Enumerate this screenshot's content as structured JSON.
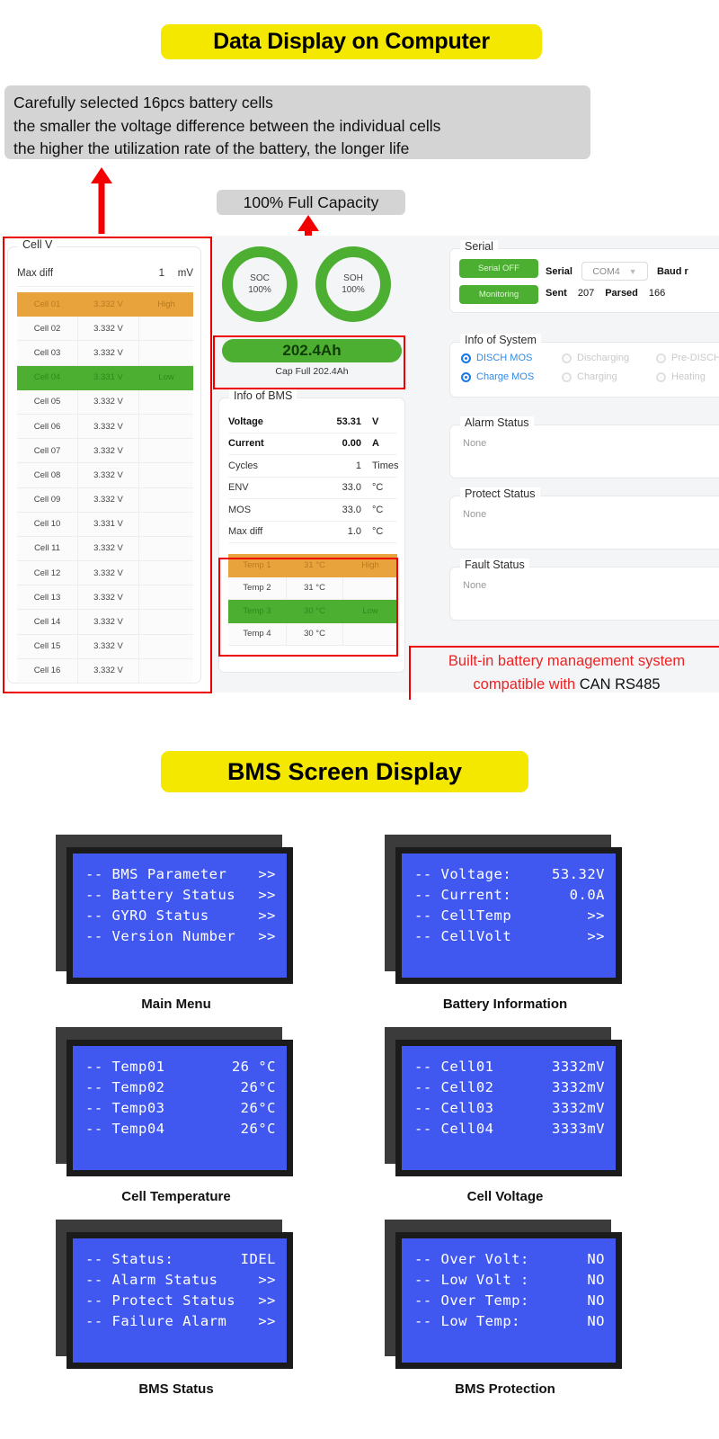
{
  "banners": {
    "top": "Data Display on Computer",
    "bms": "BMS Screen Display"
  },
  "note": {
    "line1": "Carefully selected 16pcs battery cells",
    "line2": "the smaller the voltage difference between the individual cells",
    "line3": "the higher the utilization rate of the battery, the longer life"
  },
  "capacity_tag": "100% Full Capacity",
  "can_note": {
    "line1": "Built-in battery management system",
    "line2_red": "compatible with ",
    "line2_black": "CAN RS485"
  },
  "cell_panel": {
    "legend": "Cell V",
    "max_diff_label": "Max diff",
    "max_diff_value": "1",
    "max_diff_unit": "mV",
    "rows": [
      {
        "name": "Cell 01",
        "voltage": "3.332 V",
        "status": "High",
        "state": "hi"
      },
      {
        "name": "Cell 02",
        "voltage": "3.332 V",
        "status": "",
        "state": ""
      },
      {
        "name": "Cell 03",
        "voltage": "3.332 V",
        "status": "",
        "state": ""
      },
      {
        "name": "Cell 04",
        "voltage": "3.331 V",
        "status": "Low",
        "state": "lo"
      },
      {
        "name": "Cell 05",
        "voltage": "3.332 V",
        "status": "",
        "state": ""
      },
      {
        "name": "Cell 06",
        "voltage": "3.332 V",
        "status": "",
        "state": ""
      },
      {
        "name": "Cell 07",
        "voltage": "3.332 V",
        "status": "",
        "state": ""
      },
      {
        "name": "Cell 08",
        "voltage": "3.332 V",
        "status": "",
        "state": ""
      },
      {
        "name": "Cell 09",
        "voltage": "3.332 V",
        "status": "",
        "state": ""
      },
      {
        "name": "Cell 10",
        "voltage": "3.331 V",
        "status": "",
        "state": ""
      },
      {
        "name": "Cell 11",
        "voltage": "3.332 V",
        "status": "",
        "state": ""
      },
      {
        "name": "Cell 12",
        "voltage": "3.332 V",
        "status": "",
        "state": ""
      },
      {
        "name": "Cell 13",
        "voltage": "3.332 V",
        "status": "",
        "state": ""
      },
      {
        "name": "Cell 14",
        "voltage": "3.332 V",
        "status": "",
        "state": ""
      },
      {
        "name": "Cell 15",
        "voltage": "3.332 V",
        "status": "",
        "state": ""
      },
      {
        "name": "Cell 16",
        "voltage": "3.332 V",
        "status": "",
        "state": ""
      }
    ]
  },
  "gauges": {
    "soc": {
      "label": "SOC",
      "value": "100%"
    },
    "soh": {
      "label": "SOH",
      "value": "100%"
    }
  },
  "capacity": {
    "bar": "202.4Ah",
    "sub": "Cap Full  202.4Ah"
  },
  "bms_info": {
    "legend": "Info of BMS",
    "rows": [
      {
        "label": "Voltage",
        "value": "53.31",
        "unit": "V",
        "bold": true
      },
      {
        "label": "Current",
        "value": "0.00",
        "unit": "A",
        "bold": true
      },
      {
        "label": "Cycles",
        "value": "1",
        "unit": "Times",
        "bold": false
      },
      {
        "label": "ENV",
        "value": "33.0",
        "unit": "°C",
        "bold": false
      },
      {
        "label": "MOS",
        "value": "33.0",
        "unit": "°C",
        "bold": false
      },
      {
        "label": "Max diff",
        "value": "1.0",
        "unit": "°C",
        "bold": false
      }
    ],
    "temps": [
      {
        "name": "Temp 1",
        "value": "31 °C",
        "status": "High",
        "state": "hi"
      },
      {
        "name": "Temp 2",
        "value": "31 °C",
        "status": "",
        "state": ""
      },
      {
        "name": "Temp 3",
        "value": "30 °C",
        "status": "Low",
        "state": "lo"
      },
      {
        "name": "Temp 4",
        "value": "30 °C",
        "status": "",
        "state": ""
      }
    ]
  },
  "serial": {
    "legend": "Serial",
    "serial_off_button": "Serial OFF",
    "monitoring_button": "Monitoring",
    "serial_label": "Serial",
    "port_value": "COM4",
    "baud_label": "Baud r",
    "sent_label": "Sent",
    "sent_value": "207",
    "parsed_label": "Parsed",
    "parsed_value": "166"
  },
  "system": {
    "legend": "Info of System",
    "row1": [
      {
        "label": "DISCH MOS",
        "on": true
      },
      {
        "label": "Discharging",
        "on": false
      },
      {
        "label": "Pre-DISCH",
        "on": false
      }
    ],
    "row2": [
      {
        "label": "Charge MOS",
        "on": true
      },
      {
        "label": "Charging",
        "on": false
      },
      {
        "label": "Heating",
        "on": false
      }
    ]
  },
  "status_cards": [
    {
      "legend": "Alarm Status",
      "value": "None"
    },
    {
      "legend": "Protect Status",
      "value": "None"
    },
    {
      "legend": "Fault Status",
      "value": "None"
    }
  ],
  "lcd_screens": [
    {
      "caption": "Main Menu",
      "lines": [
        {
          "key": "-- BMS Parameter",
          "value": ">>"
        },
        {
          "key": "-- Battery Status",
          "value": ">>"
        },
        {
          "key": "-- GYRO Status",
          "value": ">>"
        },
        {
          "key": "-- Version Number",
          "value": ">>"
        }
      ]
    },
    {
      "caption": "Battery Information",
      "lines": [
        {
          "key": "-- Voltage:",
          "value": "53.32V"
        },
        {
          "key": "-- Current:",
          "value": "0.0A"
        },
        {
          "key": "-- CellTemp",
          "value": ">>"
        },
        {
          "key": "-- CellVolt",
          "value": ">>"
        }
      ]
    },
    {
      "caption": "Cell Temperature",
      "lines": [
        {
          "key": "-- Temp01",
          "value": "26 °C"
        },
        {
          "key": "-- Temp02",
          "value": "26°C"
        },
        {
          "key": "-- Temp03",
          "value": "26°C"
        },
        {
          "key": "-- Temp04",
          "value": "26°C"
        }
      ]
    },
    {
      "caption": "Cell Voltage",
      "lines": [
        {
          "key": "-- Cell01",
          "value": "3332mV"
        },
        {
          "key": "-- Cell02",
          "value": "3332mV"
        },
        {
          "key": "-- Cell03",
          "value": "3332mV"
        },
        {
          "key": "-- Cell04",
          "value": "3333mV"
        }
      ]
    },
    {
      "caption": "BMS Status",
      "lines": [
        {
          "key": "-- Status:",
          "value": "IDEL"
        },
        {
          "key": "-- Alarm Status",
          "value": ">>"
        },
        {
          "key": "-- Protect Status",
          "value": ">>"
        },
        {
          "key": "-- Failure Alarm",
          "value": ">>"
        }
      ]
    },
    {
      "caption": "BMS Protection",
      "lines": [
        {
          "key": "-- Over Volt:",
          "value": "NO"
        },
        {
          "key": "-- Low Volt :",
          "value": "NO"
        },
        {
          "key": "-- Over Temp:",
          "value": "NO"
        },
        {
          "key": "-- Low Temp:",
          "value": "NO"
        }
      ]
    }
  ],
  "colors": {
    "banner_yellow": "#f5e800",
    "green": "#4caf32",
    "orange": "#e8a33d",
    "red": "#ee0000",
    "lcd_blue": "#4158f0",
    "radio_blue": "#1a79e8"
  }
}
